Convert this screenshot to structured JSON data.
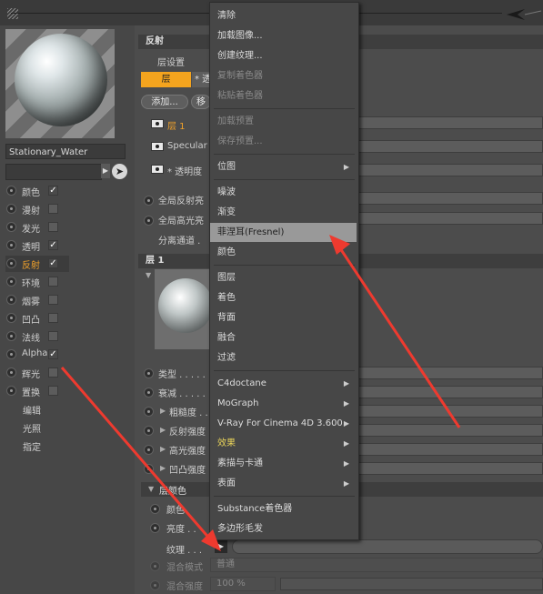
{
  "left_panel": {
    "material_name": "Stationary_Water",
    "channels": [
      {
        "label": "颜色",
        "checked": true,
        "highlight": false
      },
      {
        "label": "漫射",
        "checked": false,
        "highlight": false
      },
      {
        "label": "发光",
        "checked": false,
        "highlight": false
      },
      {
        "label": "透明",
        "checked": true,
        "highlight": false
      },
      {
        "label": "反射",
        "checked": true,
        "highlight": true
      },
      {
        "label": "环境",
        "checked": false,
        "highlight": false
      },
      {
        "label": "烟雾",
        "checked": false,
        "highlight": false
      },
      {
        "label": "凹凸",
        "checked": false,
        "highlight": false
      },
      {
        "label": "法线",
        "checked": false,
        "highlight": false
      },
      {
        "label": "Alpha",
        "checked": true,
        "highlight": false
      },
      {
        "label": "辉光",
        "checked": false,
        "highlight": false
      },
      {
        "label": "置换",
        "checked": false,
        "highlight": false
      }
    ],
    "extras": [
      "编辑",
      "光照",
      "指定"
    ],
    "check_mark": "✓"
  },
  "reflect": {
    "section_title": "反射",
    "layer_settings": "层设置",
    "layer_tab": "层",
    "layer_tab2": "* 透",
    "add_button": "添加...",
    "remove_button": "移",
    "layers": [
      {
        "label": "层 1",
        "highlight": true
      },
      {
        "label": "Specular",
        "highlight": false
      },
      {
        "label": "* 透明度",
        "highlight": false
      }
    ],
    "global_reflect": "全局反射亮",
    "global_spec": "全局高光亮",
    "sep_pass": "分离通道 ."
  },
  "layer1": {
    "section_title": "层 1",
    "params": [
      "类型 . . . . .",
      "衰减 . . . . .",
      "粗糙度 . . .",
      "反射强度 . .",
      "高光强度 . .",
      "凹凸强度 . ."
    ],
    "layer_color": "层颜色",
    "color": "颜色",
    "brightness": "亮度 . .",
    "texture": "纹理 . . .",
    "blend_mode": "混合模式",
    "blend_mode_value": "普通",
    "blend_strength": "混合强度",
    "blend_strength_value": "100 %"
  },
  "menu": {
    "items": [
      {
        "label": "清除",
        "type": "normal"
      },
      {
        "label": "加载图像...",
        "type": "normal"
      },
      {
        "label": "创建纹理...",
        "type": "normal"
      },
      {
        "label": "复制着色器",
        "type": "disabled"
      },
      {
        "label": "粘贴着色器",
        "type": "disabled"
      },
      {
        "type": "sep"
      },
      {
        "label": "加载预置",
        "type": "disabled"
      },
      {
        "label": "保存预置...",
        "type": "disabled"
      },
      {
        "type": "sep"
      },
      {
        "label": "位图",
        "type": "normal",
        "sub": true
      },
      {
        "type": "sep"
      },
      {
        "label": "噪波",
        "type": "normal"
      },
      {
        "label": "渐变",
        "type": "normal"
      },
      {
        "label": "菲涅耳(Fresnel)",
        "type": "highlight"
      },
      {
        "label": "颜色",
        "type": "normal"
      },
      {
        "type": "sep"
      },
      {
        "label": "图层",
        "type": "normal"
      },
      {
        "label": "着色",
        "type": "normal"
      },
      {
        "label": "背面",
        "type": "normal"
      },
      {
        "label": "融合",
        "type": "normal"
      },
      {
        "label": "过滤",
        "type": "normal"
      },
      {
        "type": "sep"
      },
      {
        "label": "C4doctane",
        "type": "normal",
        "sub": true
      },
      {
        "label": "MoGraph",
        "type": "normal",
        "sub": true
      },
      {
        "label": "V-Ray For Cinema 4D 3.600",
        "type": "normal",
        "sub": true
      },
      {
        "label": "效果",
        "type": "yellow",
        "sub": true
      },
      {
        "label": "素描与卡通",
        "type": "normal",
        "sub": true
      },
      {
        "label": "表面",
        "type": "normal",
        "sub": true
      },
      {
        "type": "sep"
      },
      {
        "label": "Substance着色器",
        "type": "normal"
      },
      {
        "label": "多边形毛发",
        "type": "normal"
      }
    ],
    "sub_arrow": "▶"
  },
  "colors": {
    "accent": "#f4a41e",
    "annotation_arrow": "#ee3a2f"
  }
}
